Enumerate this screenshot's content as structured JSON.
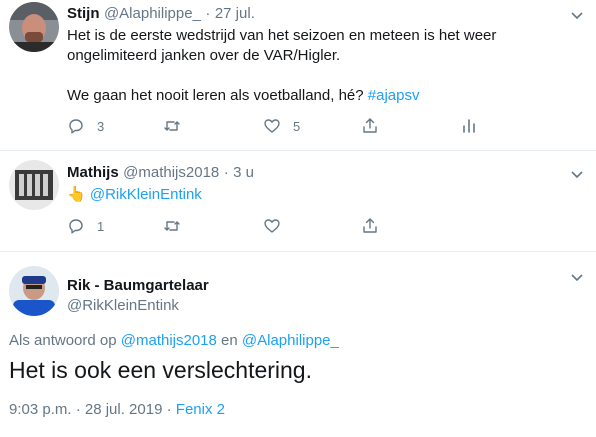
{
  "tweets": [
    {
      "name": "Stijn",
      "handle": "@Alaphilippe_",
      "separator": "·",
      "time": "27 jul.",
      "line1": "Het is de eerste wedstrijd van het seizoen en meteen is het weer",
      "line2": "ongelimiteerd janken over de VAR/Higler.",
      "line3": "We gaan het nooit leren als voetballand, hé?",
      "hashtag": "#ajapsv",
      "reply_count": "3",
      "like_count": "5"
    },
    {
      "name": "Mathijs",
      "handle": "@mathijs2018",
      "separator": "·",
      "time": "3 u",
      "emoji": "👆",
      "mention": "@RikKleinEntink",
      "reply_count": "1"
    }
  ],
  "main_tweet": {
    "name": "Rik - Baumgartelaar",
    "handle": "@RikKleinEntink",
    "reply_prefix": "Als antwoord op",
    "reply_user1": "@mathijs2018",
    "reply_and": "en",
    "reply_user2": "@Alaphilippe_",
    "text": "Het is ook een verslechtering.",
    "timestamp": "9:03 p.m. · 28 jul. 2019",
    "separator": "·",
    "source": "Fenix 2"
  },
  "colors": {
    "link": "#1da1f2",
    "secondary": "#657786",
    "text": "#14171a"
  }
}
